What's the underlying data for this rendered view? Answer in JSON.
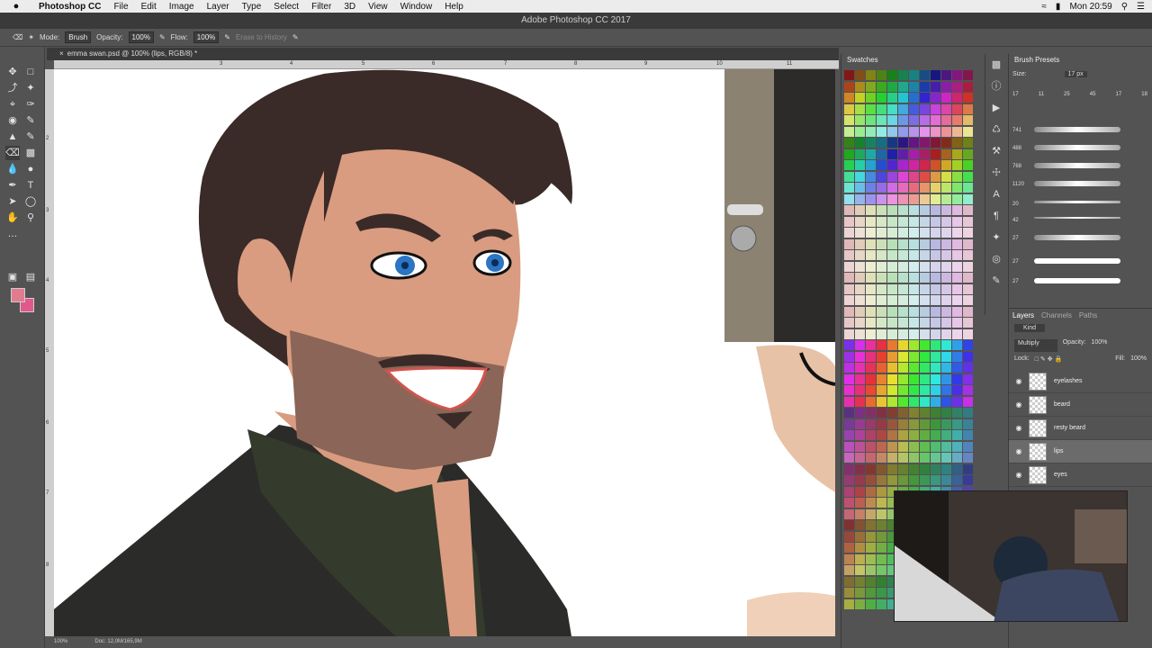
{
  "menubar": {
    "apple": "",
    "app_name": "Photoshop CC",
    "items": [
      "File",
      "Edit",
      "Image",
      "Layer",
      "Type",
      "Select",
      "Filter",
      "3D",
      "View",
      "Window",
      "Help"
    ],
    "time": "Mon 20:59"
  },
  "window_title": "Adobe Photoshop CC 2017",
  "options": {
    "mode_label": "Mode:",
    "mode_value": "Brush",
    "opacity_label": "Opacity:",
    "opacity_value": "100%",
    "flow_label": "Flow:",
    "flow_value": "100%",
    "erase_history": "Erase to History"
  },
  "document_tab": "emma swan.psd @ 100% (lips, RGB/8) *",
  "ruler_h_ticks": [
    "3",
    "4",
    "5",
    "6",
    "7",
    "8",
    "9",
    "10",
    "11"
  ],
  "ruler_v_ticks": [
    "2",
    "3",
    "4",
    "5",
    "6",
    "7",
    "8"
  ],
  "status": {
    "zoom": "100%",
    "doc": "Doc: 12,0M/165,9M"
  },
  "swatches_title": "Swatches",
  "brush_presets": {
    "title": "Brush Presets",
    "size_label": "Size:",
    "size_value": "17 px",
    "tip_sizes": [
      "17",
      "11",
      "25",
      "45",
      "17",
      "18"
    ],
    "stroke_sizes": [
      "741",
      "488",
      "768",
      "1120",
      "20",
      "42",
      "27",
      "27",
      "27"
    ]
  },
  "layers_panel": {
    "tabs": [
      "Layers",
      "Channels",
      "Paths"
    ],
    "kind": "Kind",
    "blend_mode": "Multiply",
    "opacity_label": "Opacity:",
    "opacity_value": "100%",
    "lock_label": "Lock:",
    "fill_label": "Fill:",
    "fill_value": "100%",
    "layers": [
      {
        "name": "eyelashes",
        "selected": false
      },
      {
        "name": "beard",
        "selected": false
      },
      {
        "name": "resty beard",
        "selected": false
      },
      {
        "name": "lips",
        "selected": true
      },
      {
        "name": "eyes",
        "selected": false
      }
    ]
  },
  "colors": {
    "foreground": "#e27b8d",
    "background": "#e2588c",
    "skin": "#d99c80",
    "hair": "#3a2b28",
    "beard": "#8a6558",
    "jacket": "#2b2b29"
  }
}
